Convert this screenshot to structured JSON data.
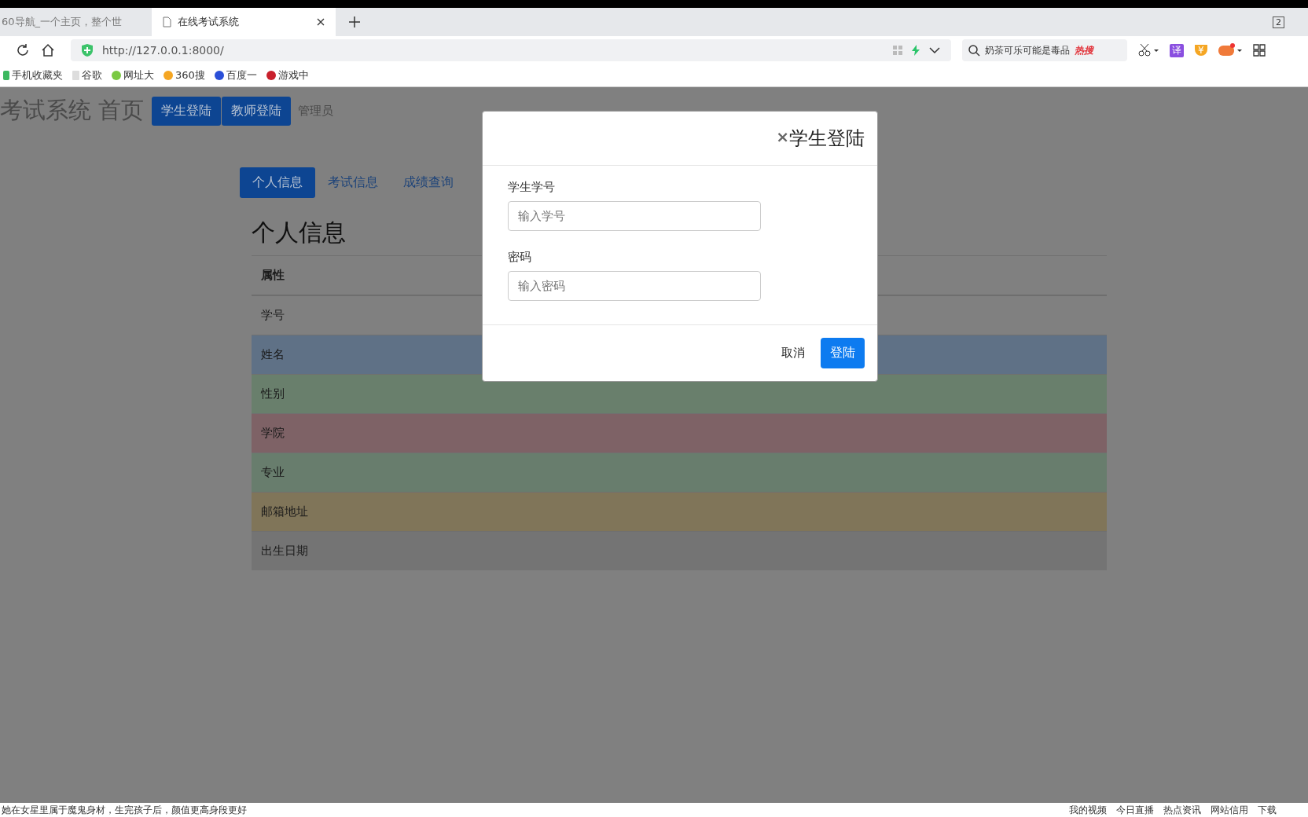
{
  "browser": {
    "tabs": [
      {
        "title": "60导航_一个主页，整个世",
        "selected": false
      },
      {
        "title": "在线考试系统",
        "selected": true
      }
    ],
    "tab_count": "2",
    "url": "http://127.0.0.1:8000/",
    "search": {
      "value": "奶茶可乐可能是毒品",
      "badge": "热搜"
    },
    "translate_label": "译",
    "shield_label": "¥",
    "bookmarks": [
      "手机收藏夹",
      "谷歌",
      "网址大",
      "360搜",
      "百度一",
      "游戏中"
    ]
  },
  "navbar": {
    "brand": "考试系统 首页",
    "buttons": [
      "学生登陆",
      "教师登陆"
    ],
    "link": "管理员"
  },
  "pills": [
    {
      "label": "个人信息",
      "selected": true
    },
    {
      "label": "考试信息",
      "selected": false
    },
    {
      "label": "成绩查询",
      "selected": false
    }
  ],
  "section_title": "个人信息",
  "table": {
    "header": "属性",
    "rows": [
      {
        "label": "学号",
        "color": "#808080"
      },
      {
        "label": "姓名",
        "color": "#5f7186"
      },
      {
        "label": "性别",
        "color": "#697f6c"
      },
      {
        "label": "学院",
        "color": "#7e6266"
      },
      {
        "label": "专业",
        "color": "#687d6d"
      },
      {
        "label": "邮箱地址",
        "color": "#807559"
      },
      {
        "label": "出生日期",
        "color": "#747474"
      }
    ]
  },
  "modal": {
    "close": "×",
    "title": "学生登陆",
    "fields": [
      {
        "label": "学生学号",
        "placeholder": "输入学号"
      },
      {
        "label": "密码",
        "placeholder": "输入密码"
      }
    ],
    "cancel": "取消",
    "submit": "登陆"
  },
  "status_bar": {
    "news": "她在女星里属于魔鬼身材，生完孩子后，颜值更高身段更好",
    "links": [
      "我的视频",
      "今日直播",
      "热点资讯",
      "网站信用"
    ],
    "download": "下载"
  }
}
